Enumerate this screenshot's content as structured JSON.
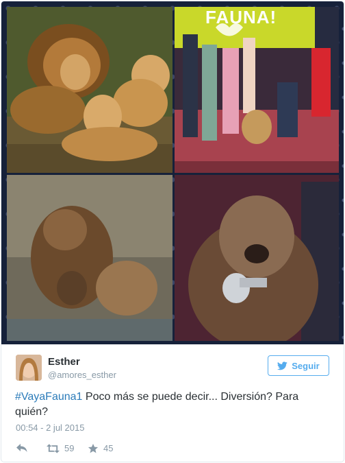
{
  "tweet": {
    "user": {
      "name": "Esther",
      "handle": "@amores_esther"
    },
    "follow_label": "Seguir",
    "hashtag": "#VayaFauna1",
    "text": " Poco más se puede decir... Diversión? Para quién?",
    "timestamp": "00:54 - 2 jul 2015",
    "retweets": "59",
    "likes": "45"
  },
  "images": {
    "show_banner_text": "FAUNA!"
  },
  "icons": {
    "reply": "reply-icon",
    "retweet": "retweet-icon",
    "like": "star-icon",
    "follow": "twitter-bird-icon"
  },
  "colors": {
    "link": "#2b7bb9",
    "follow": "#55acee",
    "muted": "#8899a6",
    "text": "#292f33"
  }
}
